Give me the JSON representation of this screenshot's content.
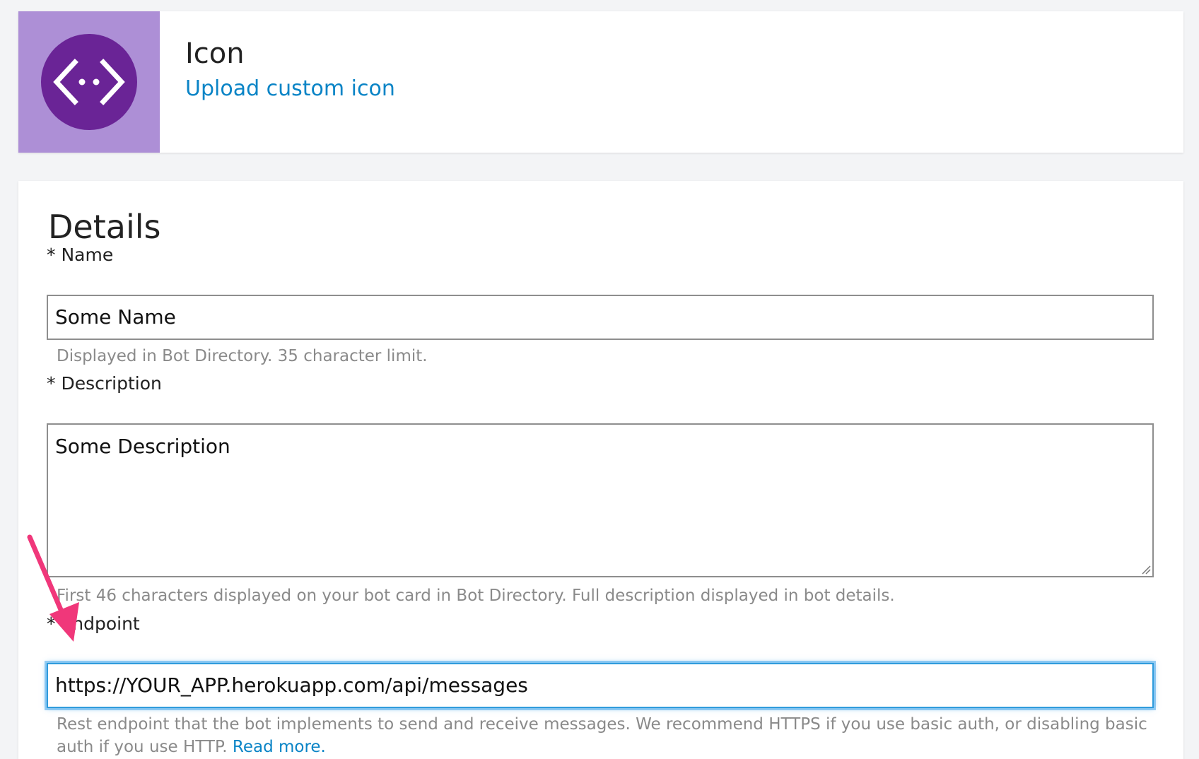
{
  "icon_section": {
    "title": "Icon",
    "upload_link": "Upload custom icon",
    "tile_color": "#ad8fd6",
    "circle_color": "#6a2496",
    "icon": "code-brackets-icon"
  },
  "details": {
    "title": "Details",
    "name": {
      "label": "* Name",
      "value": "Some Name",
      "help": "Displayed in Bot Directory. 35 character limit."
    },
    "description": {
      "label": "* Description",
      "value": "Some Description",
      "help": "First 46 characters displayed on your bot card in Bot Directory. Full description displayed in bot details."
    },
    "endpoint": {
      "label": "* Endpoint",
      "value": "https://YOUR_APP.herokuapp.com/api/messages",
      "help": "Rest endpoint that the bot implements to send and receive messages. We recommend HTTPS if you use basic auth, or disabling basic auth if you use HTTP.",
      "read_more": "Read more."
    }
  },
  "colors": {
    "link": "#0a84c6",
    "focus": "#2f9bdc",
    "annotation_arrow": "#f0377a"
  }
}
